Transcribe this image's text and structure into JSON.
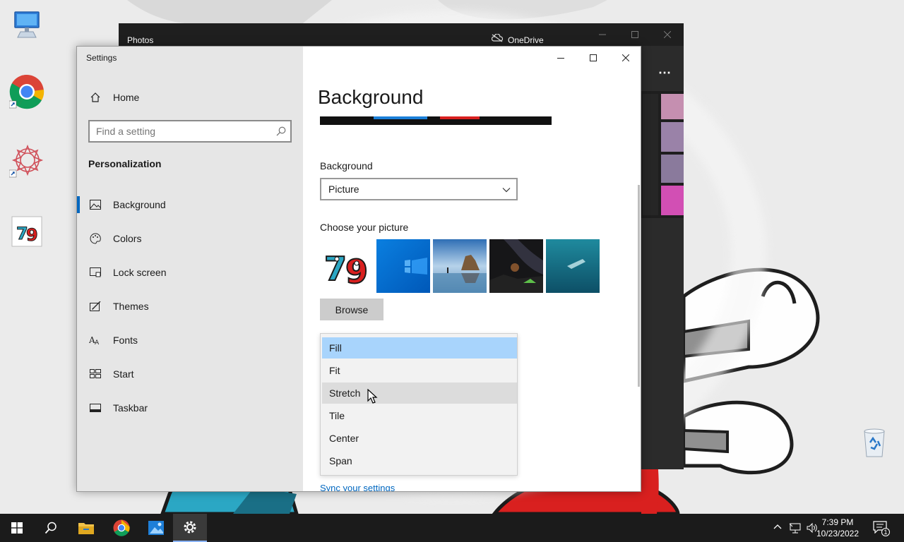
{
  "desktop": {
    "icons": [
      {
        "name": "this-pc-icon"
      },
      {
        "name": "chrome-shortcut-icon"
      },
      {
        "name": "app-shortcut-icon"
      },
      {
        "name": "image-file-icon"
      }
    ],
    "recycle_bin": {
      "name": "recycle-bin-icon"
    }
  },
  "photos_window": {
    "title": "Photos",
    "onedrive_label": "OneDrive",
    "more_label": "⋯"
  },
  "settings_window": {
    "title": "Settings",
    "sidebar": {
      "home_label": "Home",
      "search_placeholder": "Find a setting",
      "section_title": "Personalization",
      "items": [
        {
          "label": "Background",
          "icon": "picture-icon",
          "selected": true
        },
        {
          "label": "Colors",
          "icon": "palette-icon",
          "selected": false
        },
        {
          "label": "Lock screen",
          "icon": "lock-screen-icon",
          "selected": false
        },
        {
          "label": "Themes",
          "icon": "themes-icon",
          "selected": false
        },
        {
          "label": "Fonts",
          "icon": "fonts-icon",
          "selected": false
        },
        {
          "label": "Start",
          "icon": "start-icon",
          "selected": false
        },
        {
          "label": "Taskbar",
          "icon": "taskbar-icon",
          "selected": false
        }
      ]
    },
    "main": {
      "page_title": "Background",
      "background_label": "Background",
      "background_value": "Picture",
      "choose_picture_label": "Choose your picture",
      "browse_label": "Browse",
      "fit_options": [
        "Fill",
        "Fit",
        "Stretch",
        "Tile",
        "Center",
        "Span"
      ],
      "fit_selected": "Fill",
      "fit_hovered": "Stretch",
      "sync_link": "Sync your settings"
    }
  },
  "taskbar": {
    "time": "7:39 PM",
    "date": "10/23/2022",
    "notification_count": "1"
  },
  "colors": {
    "accent": "#0067c0",
    "selected_option": "#a8d4fc",
    "hover_option": "#dcdcdc",
    "taskbar": "#1b1b1b"
  }
}
